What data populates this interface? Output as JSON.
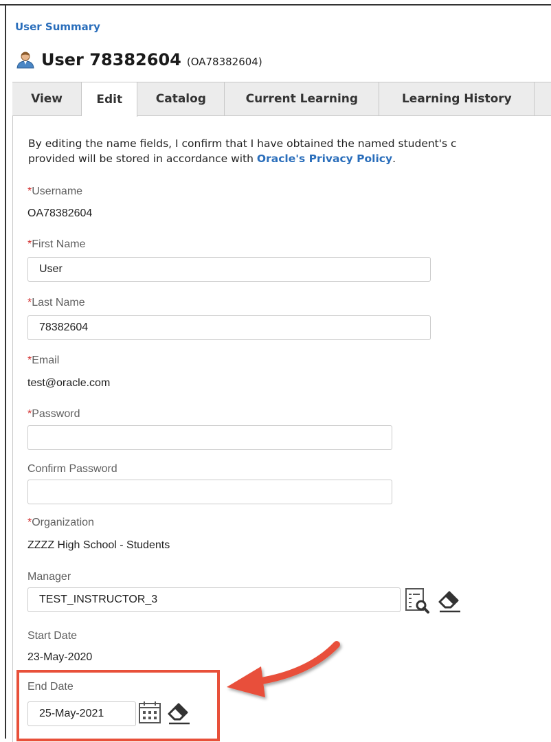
{
  "breadcrumb": "User Summary",
  "header": {
    "title": "User 78382604",
    "subtitle": "(OA78382604)",
    "icon": "user-icon"
  },
  "tabs": [
    {
      "label": "View",
      "active": false
    },
    {
      "label": "Edit",
      "active": true
    },
    {
      "label": "Catalog",
      "active": false
    },
    {
      "label": "Current Learning",
      "active": false
    },
    {
      "label": "Learning History",
      "active": false
    }
  ],
  "consent": {
    "line1": "By editing the name fields, I confirm that I have obtained the named student's c",
    "line2_prefix": "provided will be stored in accordance with ",
    "link": "Oracle's Privacy Policy",
    "line2_suffix": "."
  },
  "form": {
    "required_marker": "*",
    "username": {
      "label": "Username",
      "value": "OA78382604"
    },
    "first_name": {
      "label": "First Name",
      "value": "User"
    },
    "last_name": {
      "label": "Last Name",
      "value": "78382604"
    },
    "email": {
      "label": "Email",
      "value": "test@oracle.com"
    },
    "password": {
      "label": "Password",
      "value": ""
    },
    "confirm_password": {
      "label": "Confirm Password",
      "value": ""
    },
    "organization": {
      "label": "Organization",
      "value": "ZZZZ High School - Students"
    },
    "manager": {
      "label": "Manager",
      "value": "TEST_INSTRUCTOR_3"
    },
    "start_date": {
      "label": "Start Date",
      "value": "23-May-2020"
    },
    "end_date": {
      "label": "End Date",
      "value": "25-May-2021"
    }
  },
  "colors": {
    "link": "#2a6ebb",
    "required": "#d32f2f",
    "annotation": "#e8503a"
  }
}
